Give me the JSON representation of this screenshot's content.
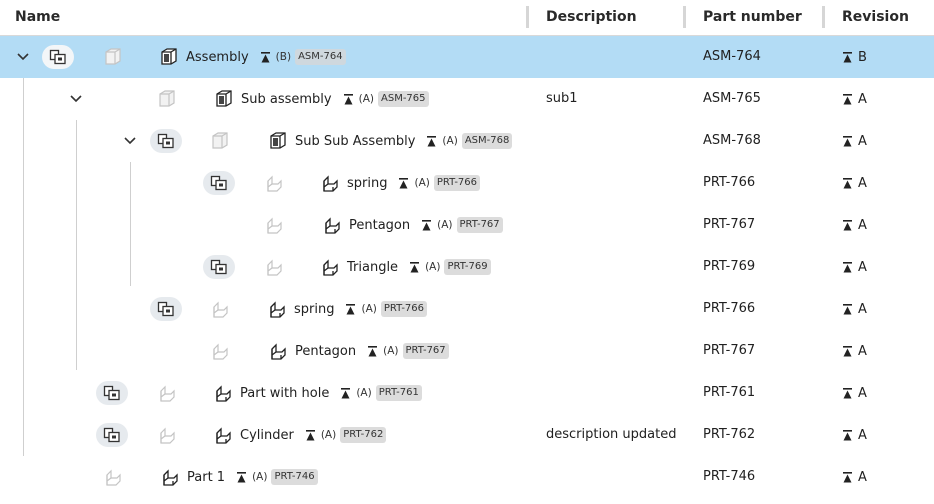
{
  "columns": {
    "name": "Name",
    "description": "Description",
    "part_number": "Part number",
    "revision": "Revision"
  },
  "rows": [
    {
      "name": "Assembly",
      "rev": "(B)",
      "pn": "ASM-764",
      "description": "",
      "part_number": "ASM-764",
      "revision": "B",
      "selected": true,
      "type": "assembly"
    },
    {
      "name": "Sub assembly",
      "rev": "(A)",
      "pn": "ASM-765",
      "description": "sub1",
      "part_number": "ASM-765",
      "revision": "A",
      "type": "assembly"
    },
    {
      "name": "Sub Sub Assembly",
      "rev": "(A)",
      "pn": "ASM-768",
      "description": "",
      "part_number": "ASM-768",
      "revision": "A",
      "type": "assembly"
    },
    {
      "name": "spring",
      "rev": "(A)",
      "pn": "PRT-766",
      "description": "",
      "part_number": "PRT-766",
      "revision": "A",
      "type": "part"
    },
    {
      "name": "Pentagon",
      "rev": "(A)",
      "pn": "PRT-767",
      "description": "",
      "part_number": "PRT-767",
      "revision": "A",
      "type": "part"
    },
    {
      "name": "Triangle",
      "rev": "(A)",
      "pn": "PRT-769",
      "description": "",
      "part_number": "PRT-769",
      "revision": "A",
      "type": "part"
    },
    {
      "name": "spring",
      "rev": "(A)",
      "pn": "PRT-766",
      "description": "",
      "part_number": "PRT-766",
      "revision": "A",
      "type": "part"
    },
    {
      "name": "Pentagon",
      "rev": "(A)",
      "pn": "PRT-767",
      "description": "",
      "part_number": "PRT-767",
      "revision": "A",
      "type": "part"
    },
    {
      "name": "Part with hole",
      "rev": "(A)",
      "pn": "PRT-761",
      "description": "",
      "part_number": "PRT-761",
      "revision": "A",
      "type": "part"
    },
    {
      "name": "Cylinder",
      "rev": "(A)",
      "pn": "PRT-762",
      "description": "description updated",
      "part_number": "PRT-762",
      "revision": "A",
      "type": "part"
    },
    {
      "name": "Part 1",
      "rev": "(A)",
      "pn": "PRT-746",
      "description": "",
      "part_number": "PRT-746",
      "revision": "A",
      "type": "part"
    }
  ],
  "icons": {
    "expand": "chevron-down-icon",
    "instances": "instances-icon",
    "assembly": "assembly-icon",
    "part": "part-icon",
    "release": "release-icon"
  },
  "colors": {
    "selected_row": "#b3dcf5",
    "pill": "#e6eaee",
    "part_number_badge": "#dcdcdc"
  }
}
